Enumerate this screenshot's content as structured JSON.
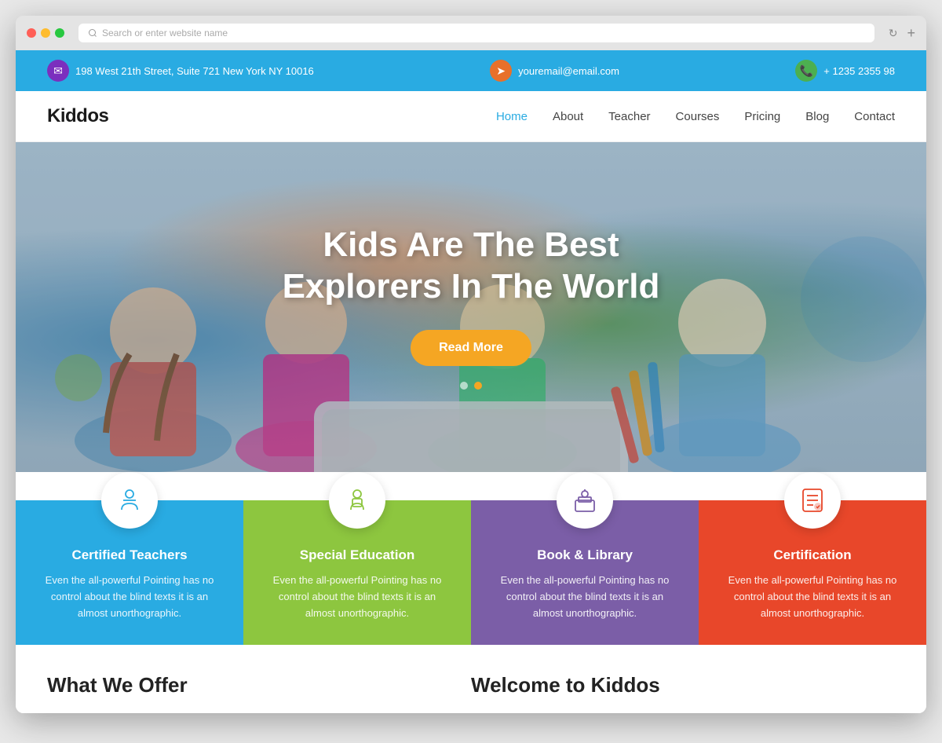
{
  "browser": {
    "address_placeholder": "Search or enter website name"
  },
  "topbar": {
    "address": "198 West 21th Street, Suite 721 New York NY 10016",
    "email": "youremail@email.com",
    "phone": "+ 1235 2355 98"
  },
  "nav": {
    "logo": "Kiddos",
    "links": [
      {
        "label": "Home",
        "active": true
      },
      {
        "label": "About",
        "active": false
      },
      {
        "label": "Teacher",
        "active": false
      },
      {
        "label": "Courses",
        "active": false
      },
      {
        "label": "Pricing",
        "active": false
      },
      {
        "label": "Blog",
        "active": false
      },
      {
        "label": "Contact",
        "active": false
      }
    ]
  },
  "hero": {
    "title_line1": "Kids Are The Best",
    "title_line2": "Explorers In The World",
    "cta_label": "Read More"
  },
  "features": [
    {
      "title": "Certified Teachers",
      "text": "Even the all-powerful Pointing has no control about the blind texts it is an almost unorthographic.",
      "icon": "👩‍🏫"
    },
    {
      "title": "Special Education",
      "text": "Even the all-powerful Pointing has no control about the blind texts it is an almost unorthographic.",
      "icon": "📖"
    },
    {
      "title": "Book & Library",
      "text": "Even the all-powerful Pointing has no control about the blind texts it is an almost unorthographic.",
      "icon": "📚"
    },
    {
      "title": "Certification",
      "text": "Even the all-powerful Pointing has no control about the blind texts it is an almost unorthographic.",
      "icon": "📜"
    }
  ],
  "bottom_teaser": {
    "left_title": "What We Offer",
    "right_title": "Welcome to Kiddos"
  }
}
